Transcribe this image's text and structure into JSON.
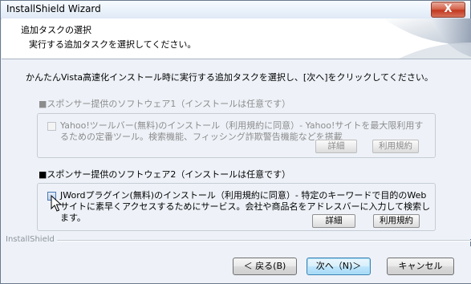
{
  "window": {
    "title": "InstallShield Wizard",
    "close_glyph": "X"
  },
  "header": {
    "title": "追加タスクの選択",
    "subtitle": "実行する追加タスクを選択してください。"
  },
  "intro": "かんたんVista高速化インストール時に実行する追加タスクを選択し、[次へ]をクリックしてください。",
  "sections": [
    {
      "title": "■スポンサー提供のソフトウェア1（インストールは任意です）",
      "checked": false,
      "enabled": false,
      "description": "Yahoo!ツールバー(無料)のインストール（利用規約に同意）- Yahoo!サイトを最大限利用するための定番ツール。検索機能、フィッシング詐欺警告機能などを搭載",
      "detail_label": "詳細",
      "terms_label": "利用規約"
    },
    {
      "title": "■スポンサー提供のソフトウェア2（インストールは任意です）",
      "checked": false,
      "enabled": true,
      "description": "JWordプラグイン(無料)のインストール（利用規約に同意）- 特定のキーワードで目的のWebサイトに素早くアクセスするためにサービス。会社や商品名をアドレスバーに入力して検索します。",
      "detail_label": "詳細",
      "terms_label": "利用規約"
    }
  ],
  "brand": "InstallShield",
  "buttons": {
    "back": "＜ 戻る(B)",
    "next": "次へ（N)＞",
    "cancel": "キャンセル"
  }
}
